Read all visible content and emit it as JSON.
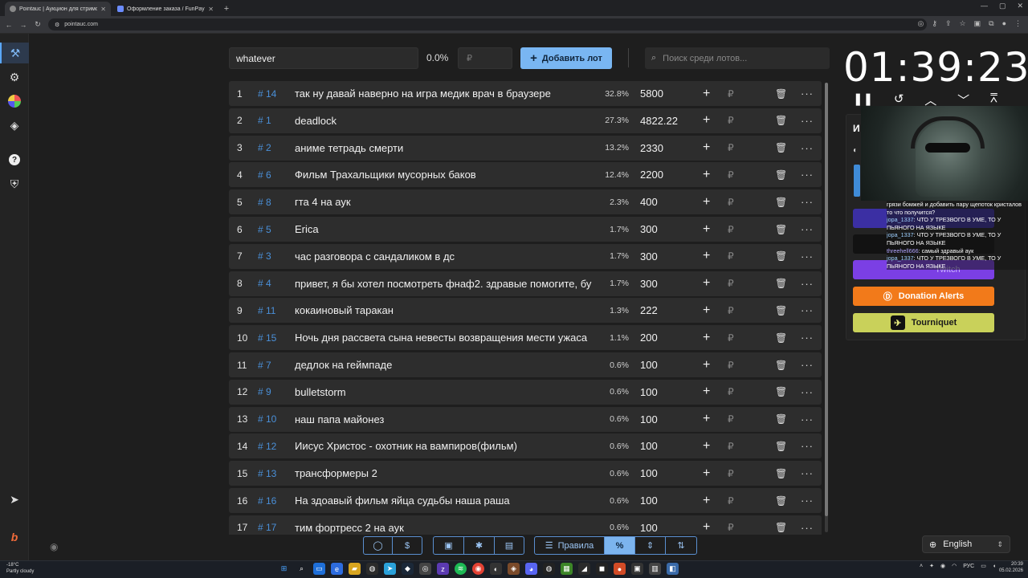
{
  "browser": {
    "tabs": [
      {
        "title": "Pointauc | Аукцион для стримо",
        "active": true
      },
      {
        "title": "Оформление заказа / FunPay",
        "active": false
      }
    ],
    "url": "pointauc.com"
  },
  "sidebar": {
    "items": [
      "gavel-icon",
      "gear-icon",
      "pie-chart-icon",
      "layers-icon",
      "help-icon",
      "shield-icon",
      "telegram-icon",
      "boosty-icon"
    ]
  },
  "controls": {
    "lot_name_value": "whatever",
    "percent": "0.0%",
    "amount_placeholder": "₽",
    "add_lot_label": "Добавить лот",
    "search_placeholder": "Поиск среди лотов..."
  },
  "lots": [
    {
      "idx": "1",
      "id": "# 14",
      "name": "так ну давай наверно на игра медик врач в браузере",
      "pct": "32.8%",
      "amount": "5800"
    },
    {
      "idx": "2",
      "id": "# 1",
      "name": "deadlock",
      "pct": "27.3%",
      "amount": "4822.22"
    },
    {
      "idx": "3",
      "id": "# 2",
      "name": "аниме тетрадь смерти",
      "pct": "13.2%",
      "amount": "2330"
    },
    {
      "idx": "4",
      "id": "# 6",
      "name": "Фильм Трахальщики мусорных баков",
      "pct": "12.4%",
      "amount": "2200"
    },
    {
      "idx": "5",
      "id": "# 8",
      "name": "гта 4 на аук",
      "pct": "2.3%",
      "amount": "400"
    },
    {
      "idx": "6",
      "id": "# 5",
      "name": "Erica",
      "pct": "1.7%",
      "amount": "300"
    },
    {
      "idx": "7",
      "id": "# 3",
      "name": "час разговора с сандаликом в дс",
      "pct": "1.7%",
      "amount": "300"
    },
    {
      "idx": "8",
      "id": "# 4",
      "name": "привет, я бы хотел посмотреть фнаф2. здравые помогите, бу",
      "pct": "1.7%",
      "amount": "300"
    },
    {
      "idx": "9",
      "id": "# 11",
      "name": "кокаиновый таракан",
      "pct": "1.3%",
      "amount": "222"
    },
    {
      "idx": "10",
      "id": "# 15",
      "name": "Ночь дня рассвета сына невесты возвращения мести ужаса",
      "pct": "1.1%",
      "amount": "200"
    },
    {
      "idx": "11",
      "id": "# 7",
      "name": "дедлок на геймпаде",
      "pct": "0.6%",
      "amount": "100"
    },
    {
      "idx": "12",
      "id": "# 9",
      "name": "bulletstorm",
      "pct": "0.6%",
      "amount": "100"
    },
    {
      "idx": "13",
      "id": "# 10",
      "name": "наш папа майонез",
      "pct": "0.6%",
      "amount": "100"
    },
    {
      "idx": "14",
      "id": "# 12",
      "name": "Иисус Христос - охотник на вампиров(фильм)",
      "pct": "0.6%",
      "amount": "100"
    },
    {
      "idx": "15",
      "id": "# 13",
      "name": "трансформеры 2",
      "pct": "0.6%",
      "amount": "100"
    },
    {
      "idx": "16",
      "id": "# 16",
      "name": "На здоавый фильм яйца судьбы наша раша",
      "pct": "0.6%",
      "amount": "100"
    },
    {
      "idx": "17",
      "id": "# 17",
      "name": "тим фортресс 2 на аук",
      "pct": "0.6%",
      "amount": "100"
    }
  ],
  "row_symbols": {
    "plus": "+",
    "rub": "₽",
    "trash": "🗑",
    "more": "···"
  },
  "timer": {
    "value": "01:39:23"
  },
  "integrations": {
    "panel_letter": "И",
    "twitch": "Twitch",
    "donation_alerts": "Donation Alerts",
    "tourniquet": "Tourniquet"
  },
  "chat": [
    {
      "user": "",
      "text": "грязи бомжей и добавить пару щепоток кристалов то что получится?"
    },
    {
      "user": "jopa_1337",
      "text": ": ЧТО У ТРЕЗВОГО В УМЕ, ТО У ПЬЯНОГО НА ЯЗЫКЕ"
    },
    {
      "user": "jopa_1337",
      "text": ": ЧТО У ТРЕЗВОГО В УМЕ, ТО У ПЬЯНОГО НА ЯЗЫКЕ"
    },
    {
      "user": "threehell666",
      "text": ": самый здравый аук"
    },
    {
      "user": "jopa_1337",
      "text": ": ЧТО У ТРЕЗВОГО В УМЕ, ТО У ПЬЯНОГО НА ЯЗЫКЕ"
    }
  ],
  "bottom_toolbar": {
    "rules_label": "Правила",
    "percent_label": "%"
  },
  "language": {
    "selected": "English"
  },
  "taskbar": {
    "weather_temp": "-18°C",
    "weather_text": "Partly cloudy",
    "lang": "РУС",
    "time": "20:39",
    "date": "05.02.2026"
  }
}
